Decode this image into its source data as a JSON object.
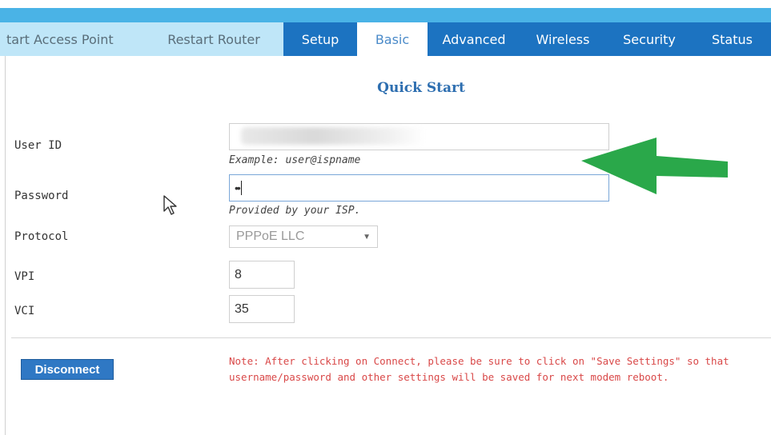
{
  "nav": {
    "tabs": [
      {
        "label": "tart Access Point"
      },
      {
        "label": "Restart Router"
      },
      {
        "label": "Setup"
      },
      {
        "label": "Basic",
        "active": true
      },
      {
        "label": "Advanced"
      },
      {
        "label": "Wireless"
      },
      {
        "label": "Security"
      },
      {
        "label": "Status"
      }
    ]
  },
  "page": {
    "title": "Quick Start"
  },
  "form": {
    "user_id": {
      "label": "User ID",
      "hint": "Example: user@ispname"
    },
    "password": {
      "label": "Password",
      "value": "••",
      "hint": "Provided by your ISP."
    },
    "protocol": {
      "label": "Protocol",
      "selected": "PPPoE LLC"
    },
    "vpi": {
      "label": "VPI",
      "value": "8"
    },
    "vci": {
      "label": "VCI",
      "value": "35"
    }
  },
  "actions": {
    "disconnect_label": "Disconnect"
  },
  "note": {
    "line1": "Note: After clicking on Connect, please be sure to click on \"Save Settings\" so that",
    "line2": "username/password and other settings will be saved for next modem reboot."
  },
  "colors": {
    "accent": "#1c73c1",
    "tab_light": "#bfe6f8",
    "note_red": "#d94848",
    "arrow_green": "#2aa84a"
  }
}
